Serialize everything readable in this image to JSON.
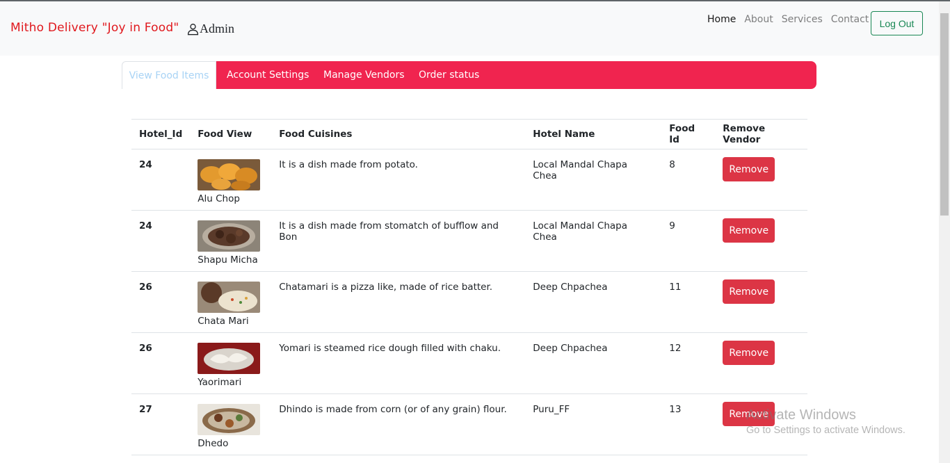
{
  "navbar": {
    "brand": "Mitho Delivery \"Joy in Food\"",
    "admin": "Admin",
    "links": [
      "Home",
      "About",
      "Services",
      "Contact"
    ],
    "logout": "Log Out"
  },
  "tabs": [
    "View Food Items",
    "Account Settings",
    "Manage Vendors",
    "Order status"
  ],
  "table": {
    "headers": [
      "Hotel_Id",
      "Food View",
      "Food Cuisines",
      "Hotel Name",
      "Food Id",
      "Remove Vendor"
    ],
    "rows": [
      {
        "hotel_id": "24",
        "food_name": "Alu Chop",
        "cuisine": "It is a dish made from potato.",
        "hotel_name": "Local Mandal Chapa Chea",
        "food_id": "8",
        "action": "Remove"
      },
      {
        "hotel_id": "24",
        "food_name": "Shapu Micha",
        "cuisine": "It is a dish made from stomatch of bufflow and Bon",
        "hotel_name": "Local Mandal Chapa Chea",
        "food_id": "9",
        "action": "Remove"
      },
      {
        "hotel_id": "26",
        "food_name": "Chata Mari",
        "cuisine": "Chatamari is a pizza like, made of rice batter.",
        "hotel_name": "Deep Chpachea",
        "food_id": "11",
        "action": "Remove"
      },
      {
        "hotel_id": "26",
        "food_name": "Yaorimari",
        "cuisine": "Yomari is steamed rice dough filled with chaku.",
        "hotel_name": "Deep Chpachea",
        "food_id": "12",
        "action": "Remove"
      },
      {
        "hotel_id": "27",
        "food_name": "Dhedo",
        "cuisine": "Dhindo is made from corn (or of any grain) flour.",
        "hotel_name": "Puru_FF",
        "food_id": "13",
        "action": "Remove"
      }
    ]
  },
  "watermark": {
    "line1": "Activate Windows",
    "line2": "Go to Settings to activate Windows."
  }
}
